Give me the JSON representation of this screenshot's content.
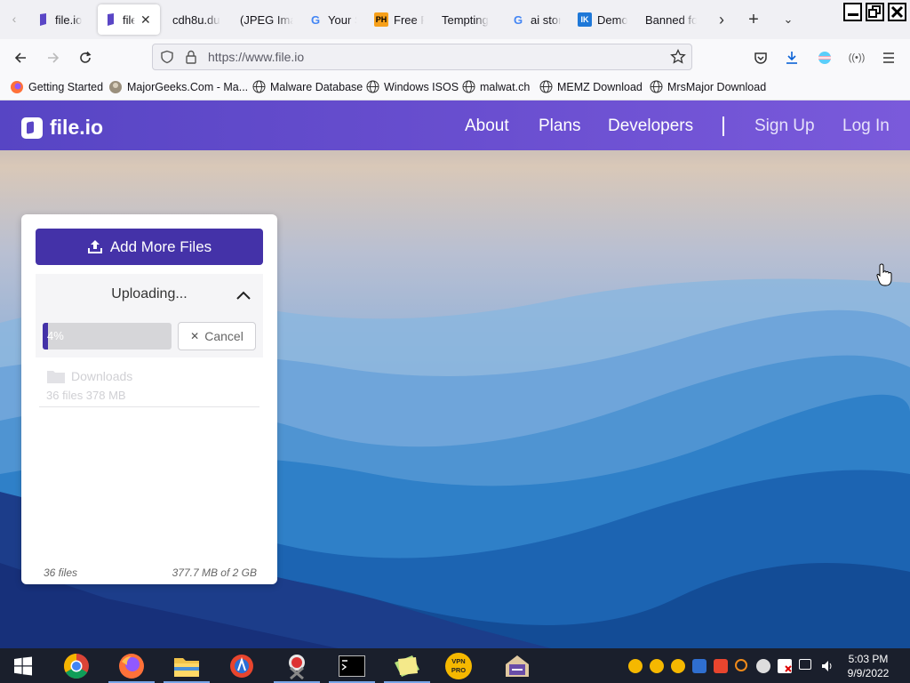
{
  "browser": {
    "tabs": [
      {
        "label": "file.io",
        "active": false
      },
      {
        "label": "file.io",
        "active": true
      },
      {
        "label": "cdh8u.du",
        "active": false
      },
      {
        "label": "(JPEG Ima",
        "active": false
      },
      {
        "label": "Your S",
        "active": false
      },
      {
        "label": "Free P",
        "active": false
      },
      {
        "label": "Tempting",
        "active": false
      },
      {
        "label": "ai stor",
        "active": false
      },
      {
        "label": "Demo",
        "active": false
      },
      {
        "label": "Banned fo",
        "active": false
      }
    ],
    "tab_icons": {
      "ph": "PH",
      "ik": "IK"
    },
    "url": "https://www.file.io",
    "bookmarks": [
      "Getting Started",
      "MajorGeeks.Com - Ma...",
      "Malware Database",
      "Windows ISOS",
      "malwat.ch",
      "MEMZ Download",
      "MrsMajor Download"
    ]
  },
  "site": {
    "logo_text": "file.io",
    "nav": {
      "about": "About",
      "plans": "Plans",
      "developers": "Developers",
      "signup": "Sign Up",
      "login": "Log In"
    },
    "card": {
      "add_button": "Add More Files",
      "status": "Uploading...",
      "progress_label": "4%",
      "progress_percent": 4,
      "cancel_button": "Cancel",
      "folder": {
        "name": "Downloads",
        "meta": "36 files 378 MB"
      },
      "footer_count": "36 files",
      "footer_size": "377.7 MB of 2 GB"
    }
  },
  "taskbar": {
    "clock_time": "5:03 PM",
    "clock_date": "9/9/2022",
    "vpn_label": "VPN PRO"
  },
  "colors": {
    "brand": "#4432a8",
    "header_gradient_start": "#5745c4",
    "header_gradient_end": "#7a5adb",
    "taskbar": "#1a1f2c"
  }
}
